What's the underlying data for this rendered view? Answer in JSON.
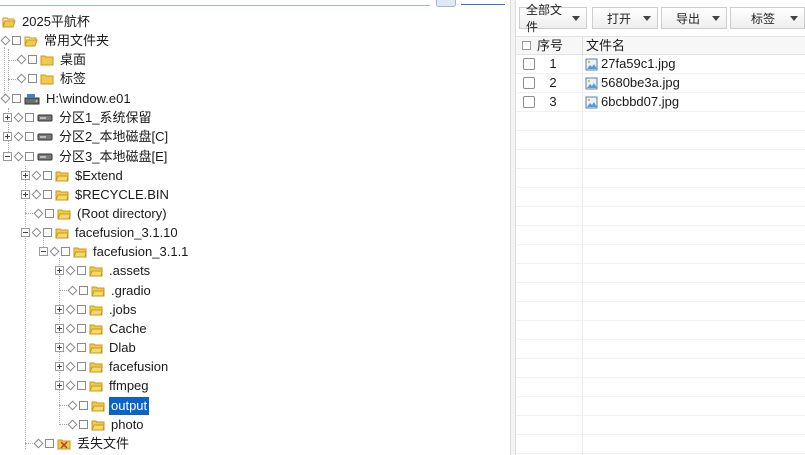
{
  "tree": {
    "items": [
      {
        "label": "2025平航杯",
        "icon": "folder-open-icon"
      },
      {
        "label": "常用文件夹",
        "icon": "folder-open-icon"
      },
      {
        "label": "桌面",
        "icon": "folder-icon"
      },
      {
        "label": "标签",
        "icon": "folder-icon"
      },
      {
        "label": "H:\\window.e01",
        "icon": "disk-image-icon"
      },
      {
        "label": "分区1_系统保留",
        "icon": "drive-icon"
      },
      {
        "label": "分区2_本地磁盘[C]",
        "icon": "drive-icon"
      },
      {
        "label": "分区3_本地磁盘[E]",
        "icon": "drive-icon"
      },
      {
        "label": "$Extend",
        "icon": "folder-icon"
      },
      {
        "label": "$RECYCLE.BIN",
        "icon": "folder-icon"
      },
      {
        "label": "(Root directory)",
        "icon": "folder-icon"
      },
      {
        "label": "facefusion_3.1.10",
        "icon": "folder-icon"
      },
      {
        "label": "facefusion_3.1.1",
        "icon": "folder-icon"
      },
      {
        "label": ".assets",
        "icon": "folder-icon"
      },
      {
        "label": ".gradio",
        "icon": "folder-icon"
      },
      {
        "label": ".jobs",
        "icon": "folder-icon"
      },
      {
        "label": "Cache",
        "icon": "folder-icon"
      },
      {
        "label": "Dlab",
        "icon": "folder-icon"
      },
      {
        "label": "facefusion",
        "icon": "folder-icon"
      },
      {
        "label": "ffmpeg",
        "icon": "folder-icon"
      },
      {
        "label": "output",
        "icon": "folder-icon",
        "selected": true
      },
      {
        "label": "photo",
        "icon": "folder-icon"
      },
      {
        "label": "丢失文件",
        "icon": "lost-files-icon"
      }
    ]
  },
  "toolbar": {
    "all_files_label": "全部文件",
    "open_label": "打开",
    "export_label": "导出",
    "tag_label": "标签"
  },
  "list": {
    "columns": {
      "index": "序号",
      "filename": "文件名"
    },
    "rows": [
      {
        "index": "1",
        "name": "27fa59c1.jpg"
      },
      {
        "index": "2",
        "name": "5680be3a.jpg"
      },
      {
        "index": "3",
        "name": "6bcbbd07.jpg"
      }
    ]
  },
  "colors": {
    "selection": "#0a64c8",
    "folder": "#f2c94c",
    "folder_stroke": "#c89a1a"
  }
}
